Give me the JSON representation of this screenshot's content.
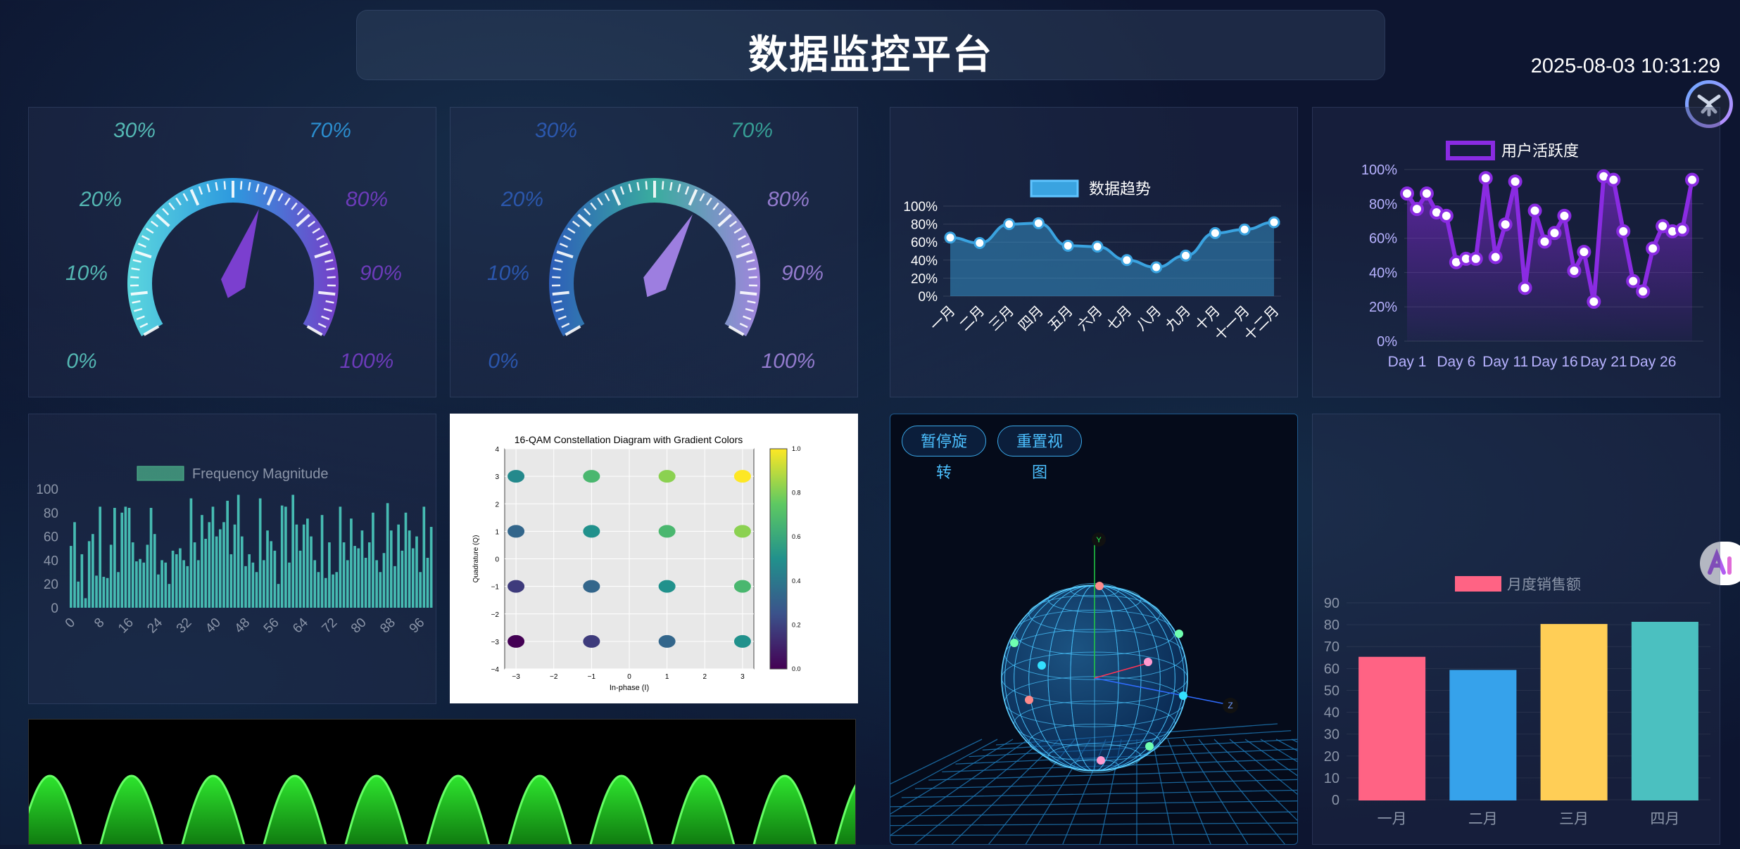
{
  "header": {
    "title": "数据监控平台",
    "datetime": "2025-08-03 10:31:29"
  },
  "gauges": [
    {
      "labels": [
        "0%",
        "10%",
        "20%",
        "30%",
        "70%",
        "80%",
        "90%",
        "100%"
      ],
      "value_pct": 58,
      "colors": {
        "low": "#5fe0e6",
        "mid": "#2e9fe6",
        "high": "#7b3fcf"
      }
    },
    {
      "labels": [
        "0%",
        "10%",
        "20%",
        "30%",
        "70%",
        "80%",
        "90%",
        "100%"
      ],
      "value_pct": 62,
      "colors": {
        "low": "#2e5fbf",
        "mid": "#3bb3a3",
        "high": "#a98ae6"
      }
    }
  ],
  "controls": {
    "pause_label": "暂停旋转",
    "reset_label": "重置视图"
  },
  "sphere_axes": {
    "y": "Y",
    "z": "Z"
  },
  "chart_data": [
    {
      "type": "area",
      "legend": "数据趋势",
      "categories": [
        "一月",
        "二月",
        "三月",
        "四月",
        "五月",
        "六月",
        "七月",
        "八月",
        "九月",
        "十月",
        "十一月",
        "十二月"
      ],
      "values": [
        65,
        59,
        80,
        81,
        56,
        55,
        40,
        32,
        45,
        70,
        74,
        82
      ],
      "ylim": [
        0,
        100
      ],
      "yticks": [
        "0%",
        "20%",
        "40%",
        "60%",
        "80%",
        "100%"
      ],
      "color": "#3aa3e0"
    },
    {
      "type": "line",
      "legend": "用户活跃度",
      "x_ticks": [
        "Day 1",
        "Day 6",
        "Day 11",
        "Day 16",
        "Day 21",
        "Day 26"
      ],
      "values": [
        86,
        77,
        86,
        75,
        73,
        46,
        48,
        48,
        95,
        49,
        68,
        93,
        31,
        76,
        58,
        63,
        73,
        41,
        52,
        23,
        96,
        94,
        64,
        35,
        29,
        54,
        67,
        64,
        65,
        94
      ],
      "ylim": [
        0,
        100
      ],
      "yticks": [
        "0%",
        "20%",
        "40%",
        "60%",
        "80%",
        "100%"
      ],
      "color": "#8a2be2"
    },
    {
      "type": "bar",
      "legend": "Frequency Magnitude",
      "values": [
        52,
        72,
        22,
        45,
        8,
        56,
        62,
        27,
        85,
        26,
        25,
        53,
        84,
        30,
        80,
        85,
        84,
        55,
        39,
        41,
        38,
        53,
        84,
        62,
        28,
        40,
        38,
        20,
        48,
        45,
        50,
        40,
        35,
        92,
        55,
        40,
        78,
        58,
        72,
        85,
        60,
        66,
        72,
        90,
        45,
        70,
        95,
        60,
        35,
        45,
        38,
        30,
        92,
        40,
        65,
        56,
        48,
        20,
        86,
        85,
        38,
        95,
        70,
        48,
        70,
        75,
        60,
        40,
        30,
        78,
        25,
        55,
        28,
        30,
        85,
        55,
        40,
        75,
        52,
        50,
        65,
        42,
        55,
        80,
        40,
        30,
        46,
        88,
        65,
        35,
        70,
        48,
        80,
        65,
        50,
        60,
        30,
        85,
        42,
        68
      ],
      "ylim": [
        0,
        100
      ],
      "yticks": [
        "0",
        "20",
        "40",
        "60",
        "80",
        "100"
      ],
      "xticks": [
        "0",
        "8",
        "16",
        "24",
        "32",
        "40",
        "48",
        "56",
        "64",
        "72",
        "80",
        "88",
        "96"
      ],
      "color": "#4fd6c5"
    },
    {
      "type": "scatter",
      "title": "16-QAM Constellation Diagram with Gradient Colors",
      "xlabel": "In-phase (I)",
      "ylabel": "Quadrature (Q)",
      "xlim": [
        -3.3,
        3.3
      ],
      "ylim": [
        -4,
        4
      ],
      "xticks": [
        "-3",
        "-2",
        "-1",
        "0",
        "1",
        "2",
        "3"
      ],
      "yticks": [
        "-4",
        "-3",
        "-2",
        "-1",
        "0",
        "1",
        "2",
        "3",
        "4"
      ],
      "colorbar_ticks": [
        "0.0",
        "0.2",
        "0.4",
        "0.6",
        "0.8",
        "1.0"
      ],
      "points": [
        {
          "x": -3,
          "y": 3,
          "c": 0.47
        },
        {
          "x": -1,
          "y": 3,
          "c": 0.67
        },
        {
          "x": 1,
          "y": 3,
          "c": 0.82
        },
        {
          "x": 3,
          "y": 3,
          "c": 1.0
        },
        {
          "x": -3,
          "y": 1,
          "c": 0.33
        },
        {
          "x": -1,
          "y": 1,
          "c": 0.5
        },
        {
          "x": 1,
          "y": 1,
          "c": 0.67
        },
        {
          "x": 3,
          "y": 1,
          "c": 0.82
        },
        {
          "x": -3,
          "y": -1,
          "c": 0.18
        },
        {
          "x": -1,
          "y": -1,
          "c": 0.33
        },
        {
          "x": 1,
          "y": -1,
          "c": 0.5
        },
        {
          "x": 3,
          "y": -1,
          "c": 0.67
        },
        {
          "x": -3,
          "y": -3,
          "c": 0.0
        },
        {
          "x": -1,
          "y": -3,
          "c": 0.18
        },
        {
          "x": 1,
          "y": -3,
          "c": 0.33
        },
        {
          "x": 3,
          "y": -3,
          "c": 0.5
        }
      ]
    },
    {
      "type": "bar",
      "legend": "月度销售额",
      "categories": [
        "一月",
        "二月",
        "三月",
        "四月"
      ],
      "values": [
        65,
        59,
        80,
        81
      ],
      "ylim": [
        0,
        90
      ],
      "yticks": [
        "0",
        "10",
        "20",
        "30",
        "40",
        "50",
        "60",
        "70",
        "80",
        "90"
      ],
      "colors": [
        "#ff6384",
        "#36a2eb",
        "#ffce56",
        "#4bc0c0"
      ]
    }
  ]
}
